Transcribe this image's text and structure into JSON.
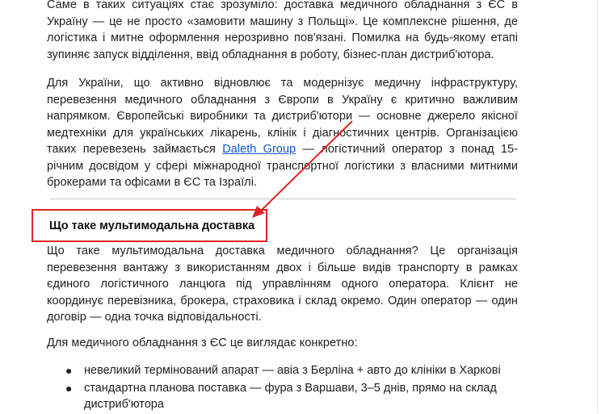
{
  "article": {
    "p1": "Саме в таких ситуаціях стає зрозуміло: доставка медичного обладнання з ЄС в Україну — це не просто «замовити машину з Польщі». Це комплексне рішення, де логістика і митне оформлення нерозривно пов'язані. Помилка на будь-якому етапі зупиняє запуск відділення, ввід обладнання в роботу, бізнес-план дистриб'ютора.",
    "p2_before": "Для України, що активно відновлює та модернізує медичну інфраструктуру, перевезення медичного обладнання з Європи в Україну є критично важливим напрямком. Європейські виробники та дистриб'ютори — основне джерело якісної медтехніки для українських лікарень, клінік і діагностичних центрів. Організацією таких перевезень займається ",
    "p2_link": "Daleth Group",
    "p2_after": " — логістичний оператор з понад 15-річним досвідом у сфері міжнародної транспортної логістики з власними митними брокерами та офісами в ЄС та Ізраїлі.",
    "heading": "Що таке мультимодальна доставка",
    "p3": "Що таке мультимодальна доставка медичного обладнання? Це організація перевезення вантажу з використанням двох і більше видів транспорту в рамках єдиного логістичного ланцюга під управлінням одного оператора. Клієнт не координує перевізника, брокера, страховика і склад окремо. Один оператор — один договір — одна точка відповідальності.",
    "p4": "Для медичного обладнання з ЄС це виглядає конкретно:",
    "bullets": [
      "невеликий термінований апарат — авіа з Берліна + авто до клініки в Харкові",
      "стандартна планова поставка — фура з Варшави, 3–5 днів, прямо на склад дистриб'ютора"
    ]
  },
  "annotation": {
    "color": "#e02424"
  },
  "colors": {
    "link": "#1155cc",
    "text": "#1f1f1f"
  }
}
